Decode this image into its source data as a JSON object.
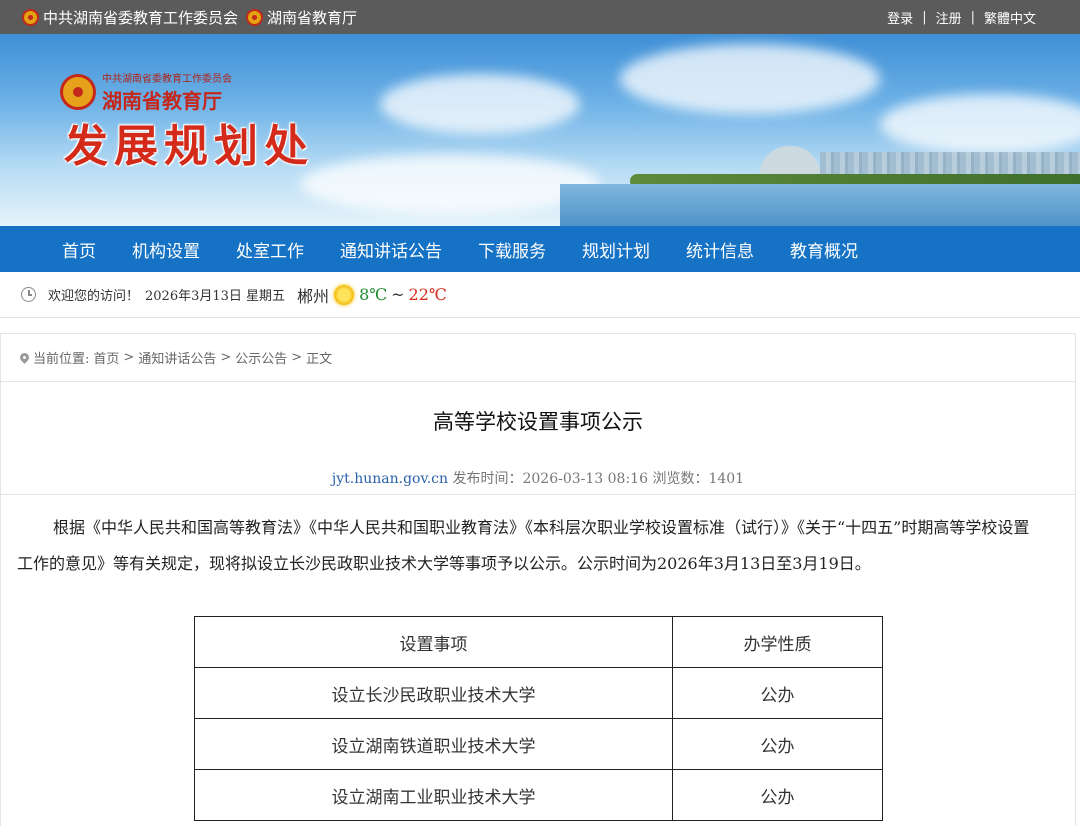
{
  "topbar": {
    "orgs": [
      "中共湖南省委教育工作委员会",
      "湖南省教育厅"
    ],
    "links": {
      "login": "登录",
      "sep1": "|",
      "register": "注册",
      "sep2": "|",
      "traditional": "繁體中文"
    }
  },
  "banner": {
    "logo_small": "中共湖南省委教育工作委员会",
    "logo_name": "湖南省教育厅",
    "dept_title": "发展规划处"
  },
  "nav": [
    "首页",
    "机构设置",
    "处室工作",
    "通知讲话公告",
    "下载服务",
    "规划计划",
    "统计信息",
    "教育概况"
  ],
  "welcome": {
    "greeting": "欢迎您的访问！",
    "date": "2026年3月13日 星期五",
    "city": "郴州",
    "temp_low": "8℃",
    "temp_sep": "~",
    "temp_high": "22℃"
  },
  "breadcrumb": {
    "label": "当前位置:",
    "items": [
      "首页",
      ">",
      "通知讲话公告",
      ">",
      "公示公告",
      ">",
      "正文"
    ]
  },
  "article": {
    "title": "高等学校设置事项公示",
    "source": "jyt.hunan.gov.cn",
    "publish_label": "发布时间：2026-03-13 08:16",
    "views_label": "浏览数：1401",
    "paragraph": "根据《中华人民共和国高等教育法》《中华人民共和国职业教育法》《本科层次职业学校设置标准（试行）》《关于“十四五”时期高等学校设置工作的意见》等有关规定，现将拟设立长沙民政职业技术大学等事项予以公示。公示时间为2026年3月13日至3月19日。",
    "table": {
      "headers": [
        "设置事项",
        "办学性质"
      ],
      "rows": [
        [
          "设立长沙民政职业技术大学",
          "公办"
        ],
        [
          "设立湖南铁道职业技术大学",
          "公办"
        ],
        [
          "设立湖南工业职业技术大学",
          "公办"
        ]
      ]
    }
  },
  "colors": {
    "nav_bg": "#1572c4",
    "title_red": "#d42a1a",
    "topbar_bg": "#5b5b5b"
  }
}
